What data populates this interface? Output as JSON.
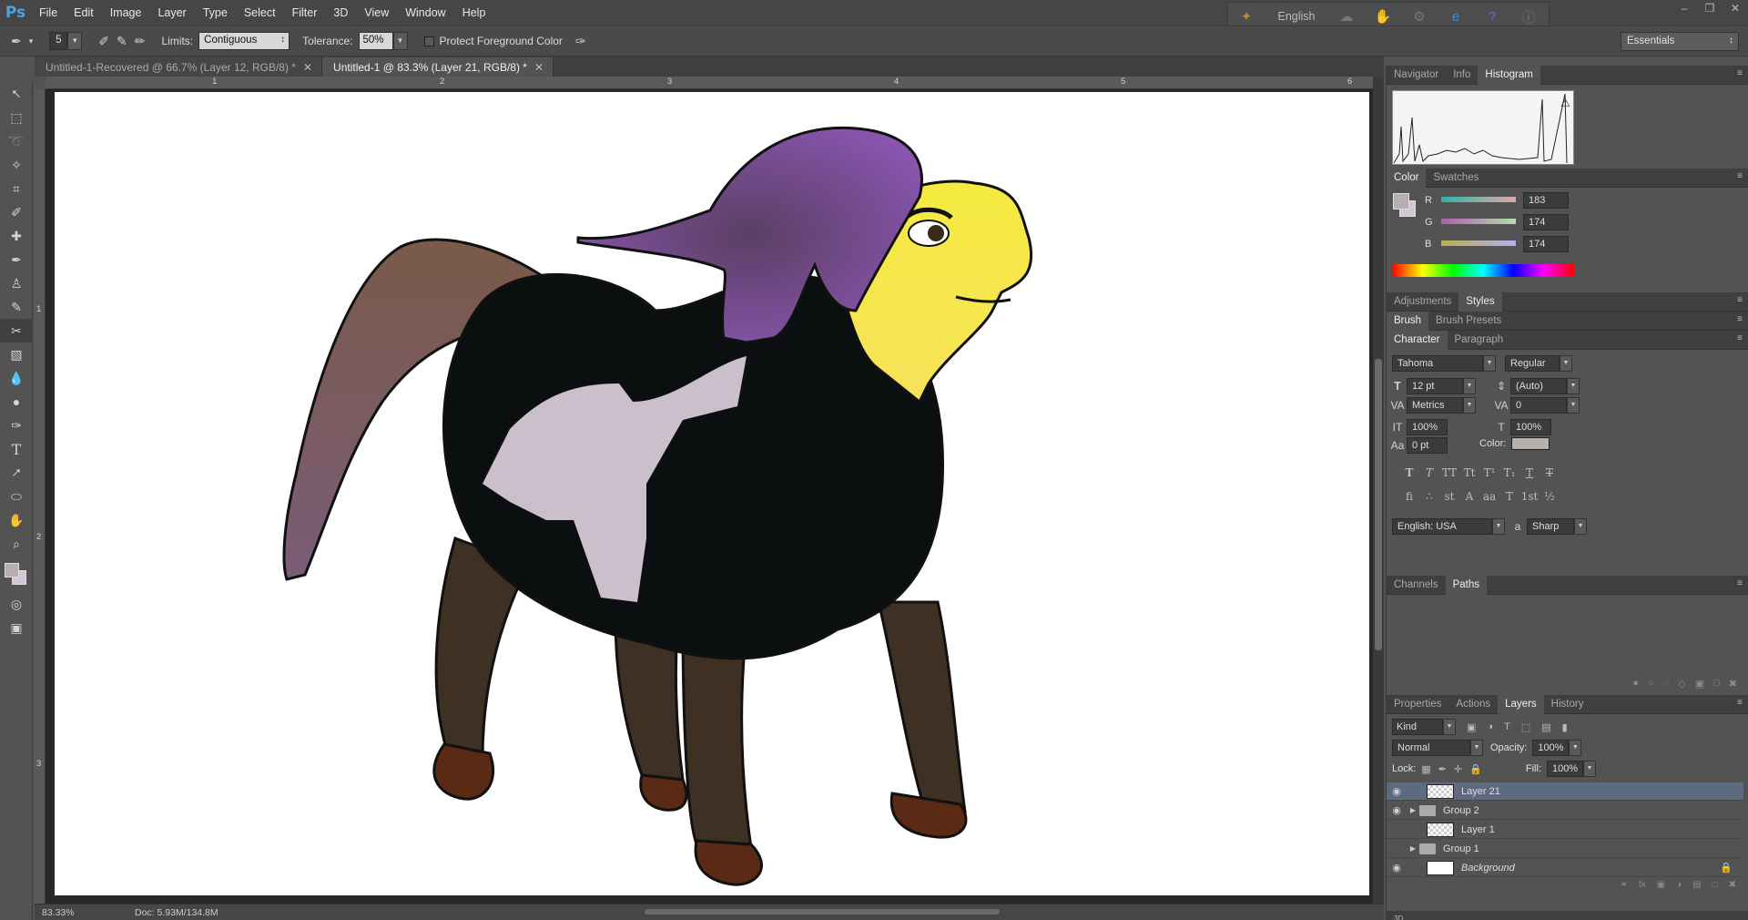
{
  "app": {
    "logo": "Ps"
  },
  "menu": [
    "File",
    "Edit",
    "Image",
    "Layer",
    "Type",
    "Select",
    "Filter",
    "3D",
    "View",
    "Window",
    "Help"
  ],
  "language_bar": {
    "language": "English"
  },
  "options": {
    "brush_size": "5",
    "limits_label": "Limits:",
    "limits_value": "Contiguous",
    "tolerance_label": "Tolerance:",
    "tolerance_value": "50%",
    "protect_label": "Protect Foreground Color",
    "workspace": "Essentials"
  },
  "tabs": [
    {
      "label": "Untitled-1-Recovered @ 66.7% (Layer 12, RGB/8) *"
    },
    {
      "label": "Untitled-1 @ 83.3% (Layer 21, RGB/8) *"
    }
  ],
  "ruler_top": [
    "1",
    "2",
    "3",
    "4",
    "5",
    "6"
  ],
  "ruler_left": [
    "1",
    "2",
    "3"
  ],
  "status": {
    "zoom": "83.33%",
    "doc": "Doc: 5.93M/134.8M"
  },
  "panels": {
    "navigator_tabs": [
      "Navigator",
      "Info",
      "Histogram"
    ],
    "color_tabs": [
      "Color",
      "Swatches"
    ],
    "color": {
      "r_label": "R",
      "g_label": "G",
      "b_label": "B",
      "r": "183",
      "g": "174",
      "b": "174",
      "fg": "#b7aeae"
    },
    "adjust_tabs": [
      "Adjustments",
      "Styles"
    ],
    "brush_tabs": [
      "Brush",
      "Brush Presets"
    ],
    "char_tabs": [
      "Character",
      "Paragraph"
    ],
    "character": {
      "font": "Tahoma",
      "style": "Regular",
      "size": "12 pt",
      "leading": "(Auto)",
      "kerning": "Metrics",
      "tracking": "0",
      "vscale": "100%",
      "hscale": "100%",
      "baseline": "0 pt",
      "color_label": "Color:",
      "language": "English: USA",
      "antialias": "Sharp",
      "aa_label": "a"
    },
    "channels_tabs": [
      "Channels",
      "Paths"
    ],
    "layers_tabs": [
      "Properties",
      "Actions",
      "Layers",
      "History"
    ],
    "layers": {
      "kind": "Kind",
      "blend": "Normal",
      "opacity_label": "Opacity:",
      "opacity": "100%",
      "lock_label": "Lock:",
      "fill_label": "Fill:",
      "fill": "100%",
      "items": [
        {
          "name": "Layer 21",
          "type": "layer"
        },
        {
          "name": "Group 2",
          "type": "group"
        },
        {
          "name": "Layer 1",
          "type": "layer"
        },
        {
          "name": "Group 1",
          "type": "group"
        },
        {
          "name": "Background",
          "type": "background"
        }
      ]
    },
    "bottom_tab": "3D"
  }
}
